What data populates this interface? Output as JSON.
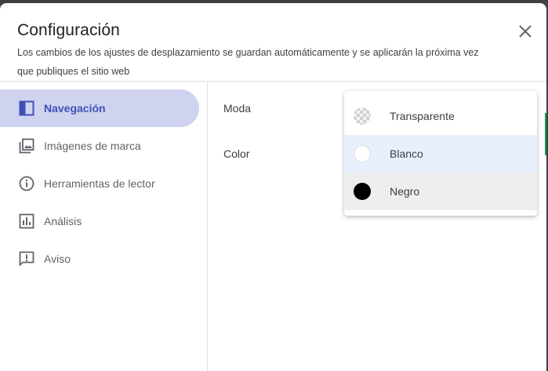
{
  "dialog": {
    "title": "Configuración",
    "subtitle": "Los cambios de los ajustes de desplazamiento se guardan automáticamente y se aplicarán la próxima vez que publiques el sitio web"
  },
  "sidebar": {
    "items": [
      {
        "label": "Navegación",
        "icon": "navigation-icon",
        "active": true
      },
      {
        "label": "Imágenes de marca",
        "icon": "image-icon"
      },
      {
        "label": "Herramientas de lector",
        "icon": "info-icon"
      },
      {
        "label": "Análisis",
        "icon": "bar-chart-icon"
      },
      {
        "label": "Aviso",
        "icon": "feedback-icon"
      }
    ]
  },
  "settings": {
    "mode_label": "Moda",
    "color_label": "Color"
  },
  "dropdown": {
    "options": [
      {
        "label": "Transparente",
        "icon": "transparent-swatch"
      },
      {
        "label": "Blanco",
        "icon": "white-swatch",
        "color": "#ffffff"
      },
      {
        "label": "Negro",
        "icon": "black-swatch",
        "color": "#000000"
      }
    ]
  },
  "colors": {
    "accent": "#3f51b5",
    "active_bg": "#cfd3f0",
    "hover_bg": "#e8f0fe"
  }
}
